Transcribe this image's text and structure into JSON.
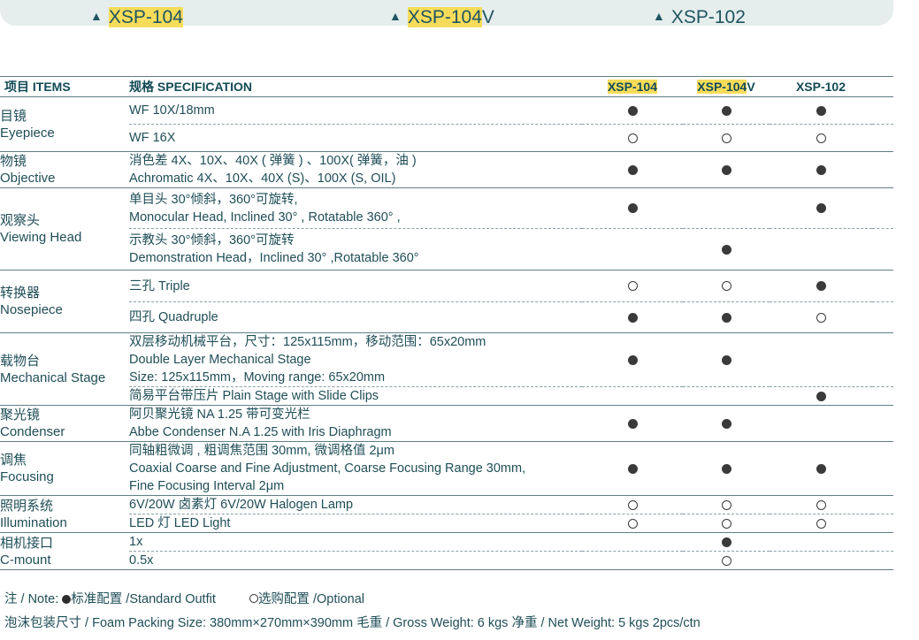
{
  "banner": {
    "models": [
      {
        "highlight": "XSP-104",
        "suffix": ""
      },
      {
        "highlight": "XSP-104",
        "suffix": "V"
      },
      {
        "highlight": "",
        "suffix": "XSP-102"
      }
    ]
  },
  "table": {
    "headers": {
      "items": "项目 ITEMS",
      "specification": "规格 SPECIFICATION",
      "models": [
        {
          "highlight": "XSP-104",
          "suffix": ""
        },
        {
          "highlight": "XSP-104",
          "suffix": "V"
        },
        {
          "highlight": "",
          "suffix": "XSP-102"
        }
      ]
    },
    "groups": [
      {
        "item": [
          "目镜",
          "Eyepiece"
        ],
        "rows": [
          {
            "spec": [
              "WF 10X/18mm"
            ],
            "marks": [
              "std",
              "std",
              "std"
            ]
          },
          {
            "spec": [
              "WF 16X"
            ],
            "marks": [
              "opt",
              "opt",
              "opt"
            ]
          }
        ]
      },
      {
        "item": [
          "物镜",
          "Objective"
        ],
        "rows": [
          {
            "spec": [
              "消色差 4X、10X、40X ( 弹簧 ) 、100X( 弹簧，油 )",
              "Achromatic  4X、10X、40X (S)、100X (S, OIL)"
            ],
            "marks": [
              "std",
              "std",
              "std"
            ]
          }
        ]
      },
      {
        "item": [
          "观察头",
          "Viewing Head"
        ],
        "rows": [
          {
            "spec": [
              "单目头 30°倾斜，360°可旋转,",
              "Monocular Head, Inclined 30° , Rotatable 360° ,"
            ],
            "marks": [
              "std",
              "",
              "std"
            ]
          },
          {
            "spec": [
              "示教头 30°倾斜，360°可旋转",
              "Demonstration Head，Inclined 30° ,Rotatable 360°"
            ],
            "marks": [
              "",
              "std",
              ""
            ]
          }
        ]
      },
      {
        "item": [
          "转换器",
          "Nosepiece"
        ],
        "rows": [
          {
            "spec": [
              "三孔  Triple"
            ],
            "marks": [
              "opt",
              "opt",
              "std"
            ]
          },
          {
            "spec": [
              "四孔  Quadruple"
            ],
            "marks": [
              "std",
              "std",
              "opt"
            ]
          }
        ]
      },
      {
        "item": [
          "载物台",
          "Mechanical Stage"
        ],
        "rows": [
          {
            "spec": [
              "双层移动机械平台，尺寸：125x115mm，移动范围：65x20mm",
              "Double Layer Mechanical Stage",
              "Size: 125x115mm，Moving range: 65x20mm"
            ],
            "marks": [
              "std",
              "std",
              ""
            ]
          },
          {
            "spec": [
              "简易平台带压片 Plain Stage with Slide Clips"
            ],
            "marks": [
              "",
              "",
              "std"
            ]
          }
        ]
      },
      {
        "item": [
          "聚光镜",
          "Condenser"
        ],
        "rows": [
          {
            "spec": [
              "阿贝聚光镜 NA 1.25 带可变光栏",
              "Abbe Condenser N.A 1.25 with Iris Diaphragm"
            ],
            "marks": [
              "std",
              "std",
              ""
            ]
          }
        ]
      },
      {
        "item": [
          "调焦",
          "Focusing"
        ],
        "rows": [
          {
            "spec": [
              "同轴粗微调 , 粗调焦范围 30mm, 微调格值 2μm",
              "Coaxial Coarse and Fine Adjustment, Coarse Focusing Range 30mm,",
              "Fine Focusing Interval 2μm"
            ],
            "marks": [
              "std",
              "std",
              "std"
            ]
          }
        ]
      },
      {
        "item": [
          "照明系统",
          "Illumination"
        ],
        "rows": [
          {
            "spec": [
              "6V/20W 卤素灯  6V/20W Halogen Lamp"
            ],
            "marks": [
              "opt",
              "opt",
              "opt"
            ]
          },
          {
            "spec": [
              "LED 灯 LED Light"
            ],
            "marks": [
              "opt",
              "opt",
              "opt"
            ]
          }
        ]
      },
      {
        "item": [
          "相机接口",
          "C-mount"
        ],
        "rows": [
          {
            "spec": [
              "1x"
            ],
            "marks": [
              "",
              "std",
              ""
            ]
          },
          {
            "spec": [
              "0.5x"
            ],
            "marks": [
              "",
              "opt",
              ""
            ]
          }
        ]
      }
    ]
  },
  "notes": {
    "note_prefix": "注 / Note: ",
    "standard": "标准配置 /Standard Outfit",
    "optional": "选购配置 /Optional",
    "packing": "泡沫包装尺寸 / Foam Packing Size: 380mm×270mm×390mm  毛重 / Gross Weight: 6 kgs   净重 / Net Weight: 5 kgs   2pcs/ctn"
  },
  "icons": {
    "standard": "filled-dot-icon",
    "optional": "hollow-dot-icon"
  },
  "colors": {
    "text": "#1f4e57",
    "highlight": "#f7dc5a",
    "banner": "#e5eded",
    "rule": "#5f7f86"
  }
}
